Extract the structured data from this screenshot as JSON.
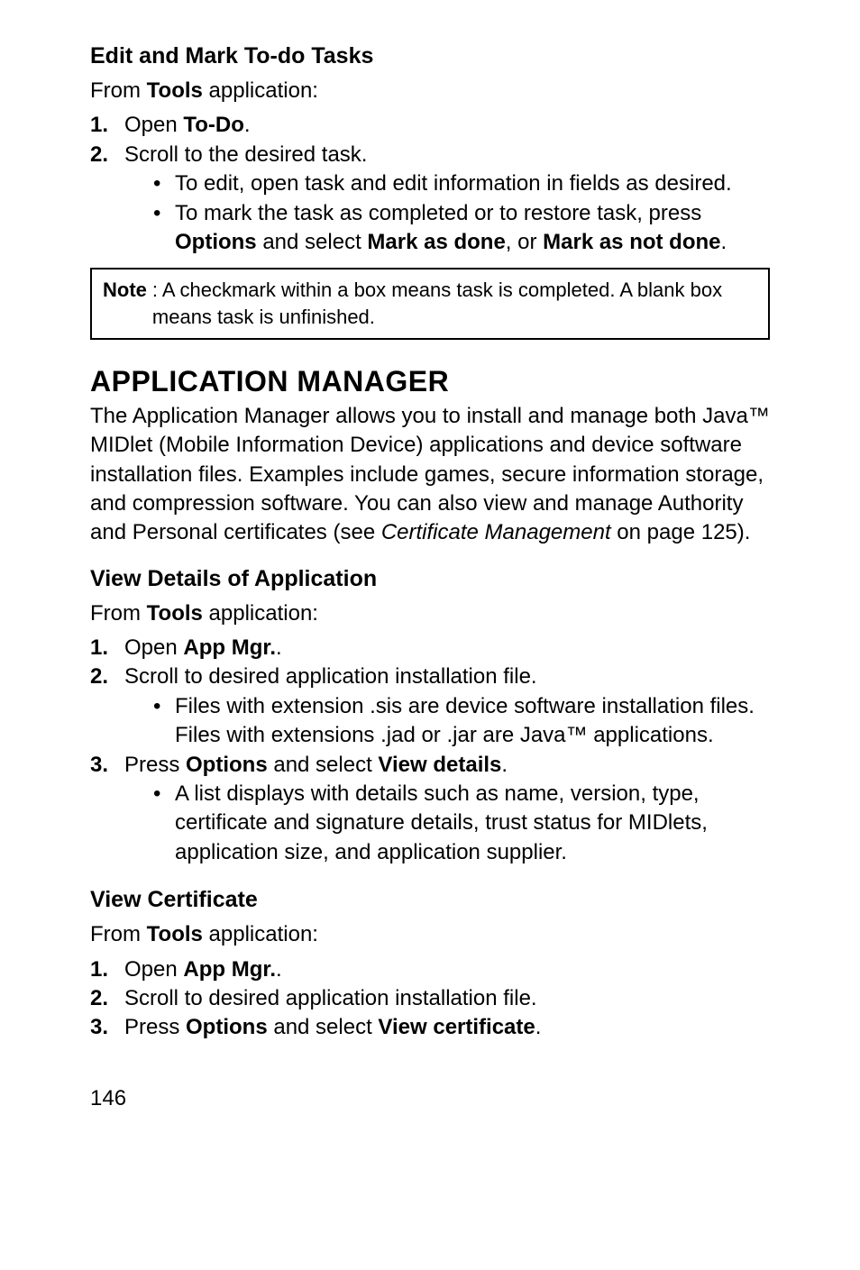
{
  "section1": {
    "heading": "Edit and Mark To-do Tasks",
    "intro_pre": "From ",
    "intro_bold": "Tools",
    "intro_post": " application:",
    "step1_pre": "Open ",
    "step1_bold": "To-Do",
    "step1_post": ".",
    "step2": "Scroll to the desired task.",
    "bullet1": "To edit, open task and edit information in fields as desired.",
    "bullet2_pre": "To mark the task as completed or to restore task, press ",
    "bullet2_b1": "Options",
    "bullet2_mid1": " and select ",
    "bullet2_b2": "Mark as done",
    "bullet2_mid2": ", or ",
    "bullet2_b3": "Mark as not done",
    "bullet2_post": ".",
    "note_label": "Note",
    "note_text": ":  A checkmark within a box means task is completed. A blank box means task is unfinished."
  },
  "section2": {
    "heading": "APPLICATION MANAGER",
    "para_pre": "The Application Manager allows you to install and manage both Java™ MIDlet (Mobile Information Device) applications and device software installation files. Examples include games, secure information storage, and compression software. You can also view and manage Authority and Personal certificates (see ",
    "para_italic": "Certificate Management",
    "para_post": " on  page 125)."
  },
  "section3": {
    "heading": "View Details of Application",
    "intro_pre": "From ",
    "intro_bold": "Tools",
    "intro_post": " application:",
    "step1_pre": "Open ",
    "step1_bold": "App Mgr.",
    "step1_post": ".",
    "step2": "Scroll to desired application installation file.",
    "s2_bullet": "Files with extension .sis are device software installation files. Files with extensions .jad or .jar are Java™ applications.",
    "step3_pre": "Press ",
    "step3_b1": "Options",
    "step3_mid": " and select ",
    "step3_b2": "View details",
    "step3_post": ".",
    "s3_bullet": "A list displays with details such as name, version, type, certificate and signature details, trust status for MIDlets, application size, and application supplier."
  },
  "section4": {
    "heading": "View Certificate",
    "intro_pre": "From ",
    "intro_bold": "Tools",
    "intro_post": " application:",
    "step1_pre": "Open ",
    "step1_bold": "App Mgr.",
    "step1_post": ".",
    "step2": "Scroll to desired application installation file.",
    "step3_pre": "Press ",
    "step3_b1": "Options",
    "step3_mid": " and select ",
    "step3_b2": "View certificate",
    "step3_post": "."
  },
  "pagenum": "146"
}
